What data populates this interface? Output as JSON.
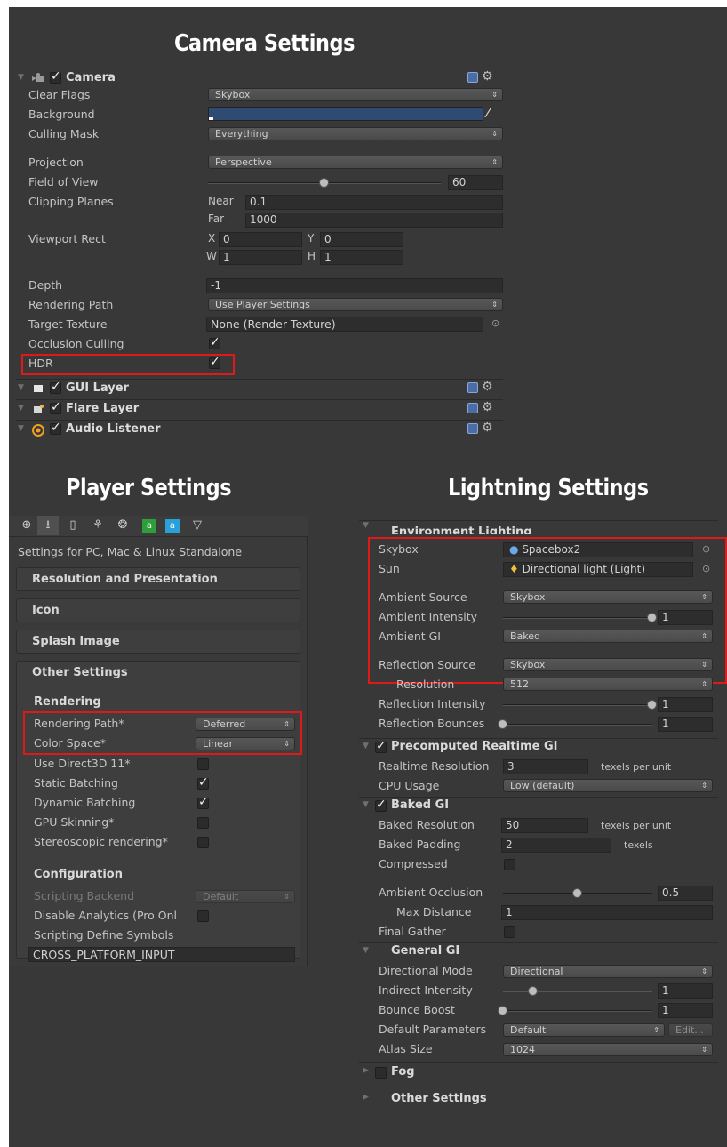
{
  "headings": {
    "camera": "Camera Settings",
    "player": "Player Settings",
    "lighting": "Lightning Settings"
  },
  "camera": {
    "title": "Camera",
    "clear_flags": {
      "label": "Clear Flags",
      "value": "Skybox"
    },
    "background": {
      "label": "Background",
      "color": "#2f4a73"
    },
    "culling_mask": {
      "label": "Culling Mask",
      "value": "Everything"
    },
    "projection": {
      "label": "Projection",
      "value": "Perspective"
    },
    "fov": {
      "label": "Field of View",
      "value": "60",
      "fraction": 0.5
    },
    "clipping": {
      "label": "Clipping Planes",
      "near_label": "Near",
      "near": "0.1",
      "far_label": "Far",
      "far": "1000"
    },
    "viewport": {
      "label": "Viewport Rect",
      "x_label": "X",
      "x": "0",
      "y_label": "Y",
      "y": "0",
      "w_label": "W",
      "w": "1",
      "h_label": "H",
      "h": "1"
    },
    "depth": {
      "label": "Depth",
      "value": "-1"
    },
    "rendering_path": {
      "label": "Rendering Path",
      "value": "Use Player Settings"
    },
    "target_texture": {
      "label": "Target Texture",
      "value": "None (Render Texture)"
    },
    "occlusion_culling": {
      "label": "Occlusion Culling",
      "checked": true
    },
    "hdr": {
      "label": "HDR",
      "checked": true
    }
  },
  "components": {
    "gui_layer": "GUI Layer",
    "flare_layer": "Flare Layer",
    "audio_listener": "Audio Listener"
  },
  "player": {
    "platform_caption": "Settings for PC, Mac & Linux Standalone",
    "groups": {
      "resolution": "Resolution and Presentation",
      "icon": "Icon",
      "splash": "Splash Image",
      "other": "Other Settings"
    },
    "rendering_header": "Rendering",
    "rendering_path": {
      "label": "Rendering Path*",
      "value": "Deferred"
    },
    "color_space": {
      "label": "Color Space*",
      "value": "Linear"
    },
    "direct3d11": {
      "label": "Use Direct3D 11*",
      "checked": false
    },
    "static_batching": {
      "label": "Static Batching",
      "checked": true
    },
    "dynamic_batching": {
      "label": "Dynamic Batching",
      "checked": true
    },
    "gpu_skinning": {
      "label": "GPU Skinning*",
      "checked": false
    },
    "stereoscopic": {
      "label": "Stereoscopic rendering*",
      "checked": false
    },
    "configuration_header": "Configuration",
    "scripting_backend": {
      "label": "Scripting Backend",
      "value": "Default"
    },
    "disable_analytics": {
      "label": "Disable Analytics (Pro Onl",
      "checked": false
    },
    "define_symbols": {
      "label": "Scripting Define Symbols",
      "value": "CROSS_PLATFORM_INPUT"
    }
  },
  "lighting": {
    "environment_header": "Environment Lighting",
    "skybox": {
      "label": "Skybox",
      "value": "Spacebox2"
    },
    "sun": {
      "label": "Sun",
      "value": "Directional light (Light)"
    },
    "ambient_source": {
      "label": "Ambient Source",
      "value": "Skybox"
    },
    "ambient_intensity": {
      "label": "Ambient Intensity",
      "value": "1",
      "fraction": 1.0
    },
    "ambient_gi": {
      "label": "Ambient GI",
      "value": "Baked"
    },
    "reflection_source": {
      "label": "Reflection Source",
      "value": "Skybox"
    },
    "resolution": {
      "label": "Resolution",
      "value": "512"
    },
    "reflection_intensity": {
      "label": "Reflection Intensity",
      "value": "1",
      "fraction": 1.0
    },
    "reflection_bounces": {
      "label": "Reflection Bounces",
      "value": "1",
      "fraction": 0.0
    },
    "precomputed_header": "Precomputed Realtime GI",
    "realtime_resolution": {
      "label": "Realtime Resolution",
      "value": "3",
      "unit": "texels per unit"
    },
    "cpu_usage": {
      "label": "CPU Usage",
      "value": "Low (default)"
    },
    "baked_header": "Baked GI",
    "baked_resolution": {
      "label": "Baked Resolution",
      "value": "50",
      "unit": "texels per unit"
    },
    "baked_padding": {
      "label": "Baked Padding",
      "value": "2",
      "unit": "texels"
    },
    "compressed": {
      "label": "Compressed",
      "checked": false
    },
    "ambient_occlusion": {
      "label": "Ambient Occlusion",
      "value": "0.5",
      "fraction": 0.5
    },
    "max_distance": {
      "label": "Max Distance",
      "value": "1"
    },
    "final_gather": {
      "label": "Final Gather",
      "checked": false
    },
    "general_header": "General GI",
    "directional_mode": {
      "label": "Directional Mode",
      "value": "Directional"
    },
    "indirect_intensity": {
      "label": "Indirect Intensity",
      "value": "1",
      "fraction": 0.2
    },
    "bounce_boost": {
      "label": "Bounce Boost",
      "value": "1",
      "fraction": 0.0
    },
    "default_parameters": {
      "label": "Default Parameters",
      "value": "Default",
      "edit": "Edit..."
    },
    "atlas_size": {
      "label": "Atlas Size",
      "value": "1024"
    },
    "fog_header": "Fog",
    "other_header": "Other Settings"
  },
  "colors": {
    "highlight": "#e01818",
    "panel": "#383838"
  }
}
